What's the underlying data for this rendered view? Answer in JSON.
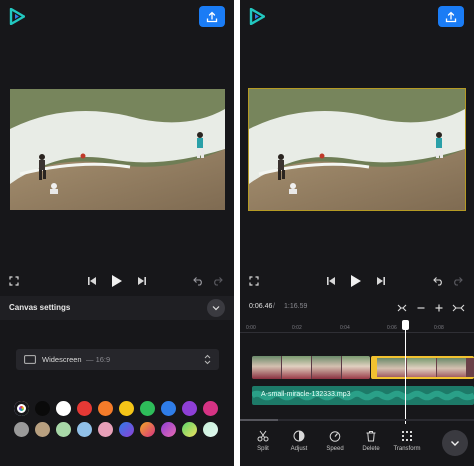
{
  "left": {
    "canvas_settings": {
      "title": "Canvas settings"
    },
    "aspect_ratio": {
      "name": "Widescreen",
      "value": "— 16:9"
    },
    "swatches_row1": [
      "picker",
      "#0a0a0a",
      "#ffffff",
      "#e53935",
      "#f57c2a",
      "#f5c518",
      "#2ebd5a",
      "#2f7de8",
      "#8e3fd6",
      "#d63384"
    ],
    "swatches_row2": [
      "#9a9a9a",
      "#b8a080",
      "#a8d8a8",
      "#90c0e8",
      "#e8a0b8",
      "gradient-blue-purple",
      "gradient-orange-pink",
      "gradient-purple-pink",
      "gradient-green-yellow",
      "gradient-mint"
    ]
  },
  "right": {
    "time": {
      "current": "0:06.46",
      "separator": "/",
      "total": "1:16.59"
    },
    "ruler_ticks": [
      "0:00",
      "0:02",
      "0:04",
      "0:06",
      "0:08"
    ],
    "audio_track": {
      "label": "A-small-miracle-132333.mp3"
    },
    "toolbar": [
      {
        "label": "Split",
        "icon": "scissors-icon"
      },
      {
        "label": "Adjust",
        "icon": "adjust-icon"
      },
      {
        "label": "Speed",
        "icon": "speed-icon"
      },
      {
        "label": "Delete",
        "icon": "trash-icon"
      },
      {
        "label": "Transform",
        "icon": "transform-icon"
      }
    ]
  },
  "colors": {
    "panel_bg": "#17171a",
    "accent_blue": "#1a7cf5",
    "logo_teal": "#22c7c0",
    "selection_yellow": "#f2c230",
    "audio_green": "#1d7a68"
  }
}
